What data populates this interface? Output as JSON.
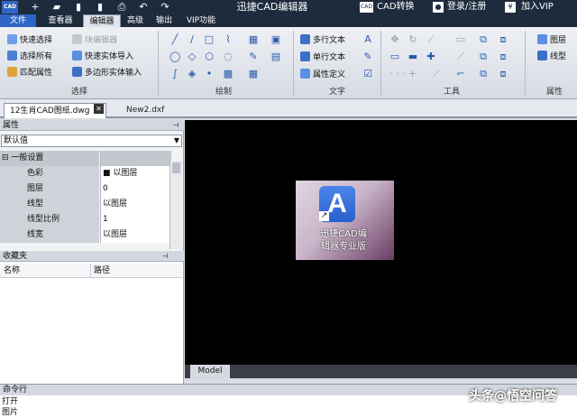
{
  "titlebar": {
    "logo": "CAD",
    "title": "迅捷CAD编辑器",
    "convert": "CAD转换",
    "login": "登录/注册",
    "vip": "加入VIP",
    "convert_badge": "CAD",
    "vip_symbol": "¥",
    "quick_access": [
      "+",
      "▰",
      "▮",
      "⎙",
      "↶",
      "↷"
    ]
  },
  "menu": {
    "file": "文件",
    "tabs": [
      "查看器",
      "编辑器",
      "高级",
      "输出",
      "VIP功能"
    ]
  },
  "ribbon": {
    "select_group": {
      "label": "选择",
      "items": [
        "快速选择",
        "选择所有",
        "匹配属性"
      ],
      "items2": [
        "块编辑器",
        "快速实体导入",
        "多边形实体输入"
      ]
    },
    "draw_group": {
      "label": "绘制"
    },
    "text_group": {
      "label": "文字",
      "items": [
        "多行文本",
        "单行文本",
        "属性定义"
      ]
    },
    "tools_group": {
      "label": "工具"
    },
    "props_group": {
      "label": "属性",
      "items": [
        "图层",
        "线型"
      ]
    }
  },
  "doc_tabs": [
    "12生肖CAD图纸.dwg",
    "New2.dxf"
  ],
  "doc_close": "✕",
  "properties": {
    "title": "属性",
    "pin": "⊣",
    "selector": "默认值",
    "group": "一般设置",
    "rows": [
      {
        "key": "色彩",
        "value": "■ 以图层"
      },
      {
        "key": "图层",
        "value": "0"
      },
      {
        "key": "线型",
        "value": "以图层"
      },
      {
        "key": "线型比例",
        "value": "1"
      },
      {
        "key": "线宽",
        "value": "以图层"
      }
    ]
  },
  "favorites": {
    "title": "收藏夹",
    "pin": "⊣",
    "columns": [
      "名称",
      "路径"
    ]
  },
  "canvas": {
    "thumb_line1": "迅捷CAD编",
    "thumb_line2": "辑器专业版",
    "model_tab": "Model"
  },
  "command": {
    "title": "命令行",
    "lines": [
      "打开",
      "图片"
    ]
  },
  "watermark": "头条@悟空问答"
}
